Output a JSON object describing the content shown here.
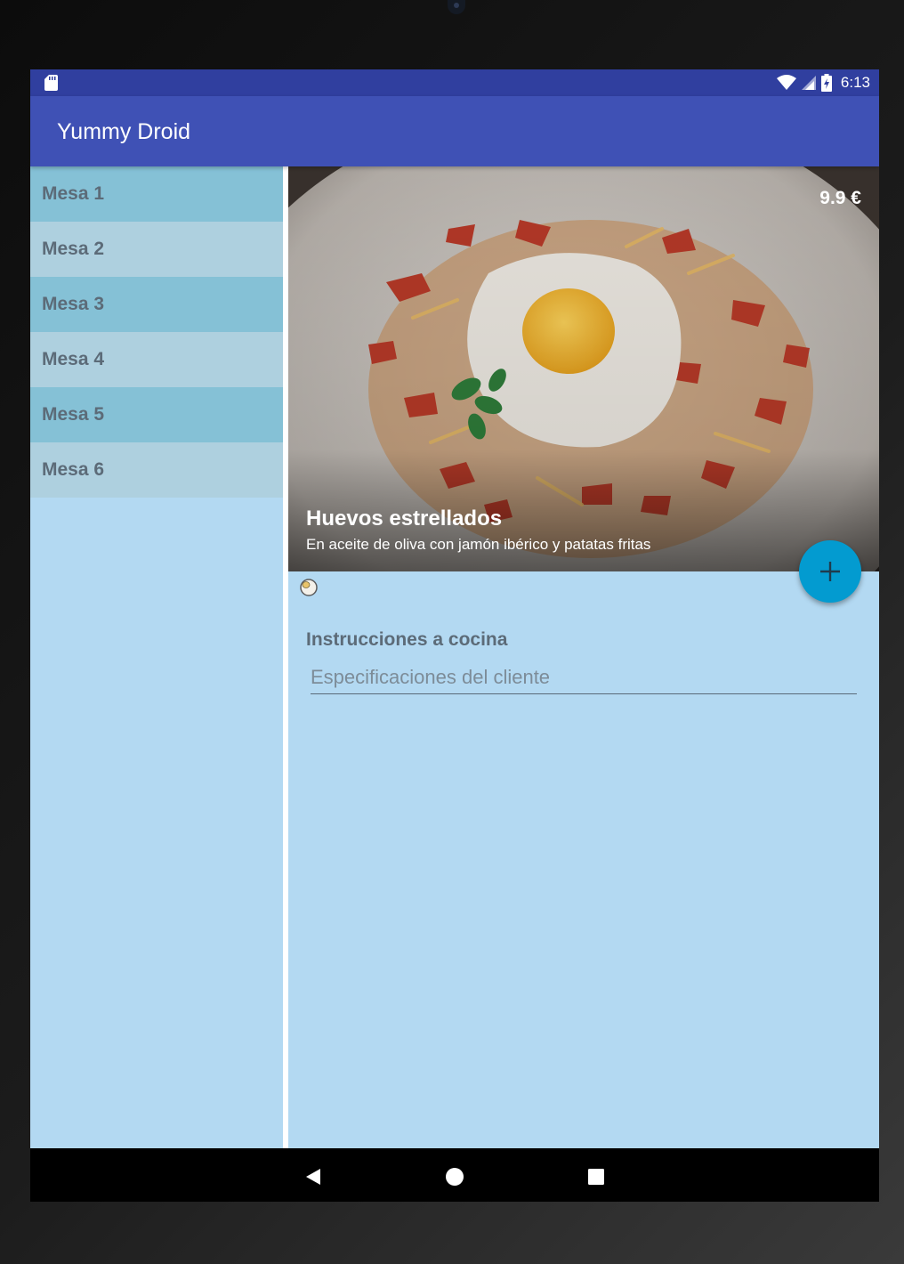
{
  "status_bar": {
    "time": "6:13",
    "icons": [
      "sd-card-icon",
      "wifi-icon",
      "signal-icon",
      "battery-charging-icon"
    ]
  },
  "app_bar": {
    "title": "Yummy Droid"
  },
  "tables": [
    {
      "label": "Mesa 1"
    },
    {
      "label": "Mesa 2"
    },
    {
      "label": "Mesa 3"
    },
    {
      "label": "Mesa 4"
    },
    {
      "label": "Mesa 5"
    },
    {
      "label": "Mesa 6"
    }
  ],
  "dish": {
    "name": "Huevos estrellados",
    "description": "En aceite de oliva con jamón ibérico y patatas fritas",
    "price": "9.9 €",
    "allergen_icons": [
      "egg-allergen-icon"
    ]
  },
  "instructions": {
    "label": "Instrucciones a cocina",
    "placeholder": "Especificaciones del cliente",
    "value": ""
  },
  "fab": {
    "icon": "plus-icon"
  },
  "nav": {
    "icons": [
      "back-icon",
      "home-icon",
      "recents-icon"
    ]
  },
  "colors": {
    "status_bar": "#303f9f",
    "app_bar": "#3f51b5",
    "list_item_dark": "#85c1d6",
    "list_item_light": "#aed0df",
    "background": "#b3d9f2",
    "fab": "#039bd0"
  }
}
